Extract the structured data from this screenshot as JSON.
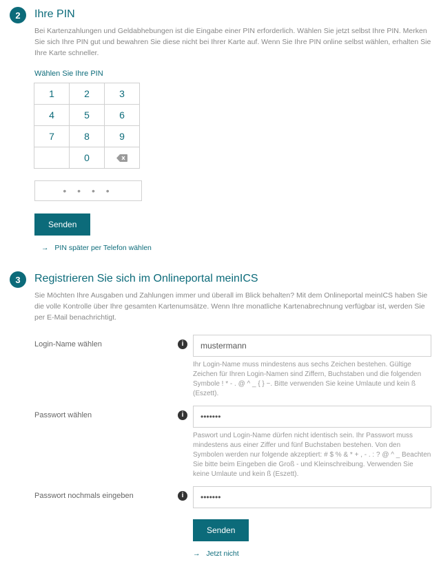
{
  "step2": {
    "number": "2",
    "title": "Ihre PIN",
    "desc": "Bei Kartenzahlungen und Geldabhebungen ist die Eingabe einer PIN erforderlich. Wählen Sie jetzt selbst Ihre PIN. Merken Sie sich Ihre PIN gut und bewahren Sie diese nicht bei Ihrer Karte auf. Wenn Sie Ihre PIN online selbst wählen, erhalten Sie Ihre Karte schneller.",
    "choose_label": "Wählen Sie Ihre PIN",
    "keys": {
      "r1": [
        "1",
        "2",
        "3"
      ],
      "r2": [
        "4",
        "5",
        "6"
      ],
      "r3": [
        "7",
        "8",
        "9"
      ],
      "r4": [
        "",
        "0",
        "⌫"
      ]
    },
    "pin_dots": "•   •   •   •",
    "submit": "Senden",
    "alt_link": "PIN später per Telefon wählen",
    "arrow": "→"
  },
  "step3": {
    "number": "3",
    "title": "Registrieren Sie sich im Onlineportal meinICS",
    "desc": "Sie Möchten Ihre Ausgaben und Zahlungen immer und überall im Blick behalten? Mit dem Onlineportal meinICS haben Sie die volle Kontrolle über Ihre gesamten Kartenumsätze. Wenn Ihre monatliche Kartenabrechnung verfügbar ist, werden Sie per E-Mail benachrichtigt.",
    "login_label": "Login-Name wählen",
    "login_value": "mustermann",
    "login_hint": "Ihr Login-Name muss mindestens aus sechs Zeichen bestehen. Gültige Zeichen für Ihren Login-Namen sind Ziffern, Buchstaben und die folgenden Symbole ! * - . @ ^ _ { } ~. Bitte verwenden Sie keine Umlaute und kein ß (Eszett).",
    "pw_label": "Passwort wählen",
    "pw_value": "•••••••",
    "pw_hint": "Paswort und Login-Name dürfen nicht identisch sein. Ihr Passwort muss mindestens aus einer Ziffer und fünf Buchstaben bestehen. Von den Symbolen werden nur folgende akzeptiert: # $ % & * + , - . : ? @ ^ _ Beachten Sie bitte beim Eingeben die Groß - und Kleinschreibung. Verwenden Sie keine Umlaute und kein ß (Eszett).",
    "pw2_label": "Passwort nochmals eingeben",
    "pw2_value": "•••••••",
    "submit": "Senden",
    "skip": "Jetzt nicht",
    "arrow": "→",
    "info": "i"
  }
}
